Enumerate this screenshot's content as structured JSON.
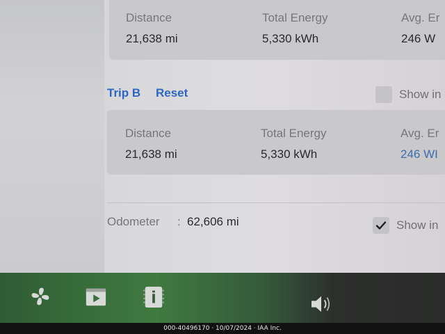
{
  "trip_a": {
    "distance_label": "Distance",
    "distance_value": "21,638 mi",
    "energy_label": "Total Energy",
    "energy_value": "5,330 kWh",
    "avg_label": "Avg. Er",
    "avg_value": "246 W"
  },
  "trip_b": {
    "title": "Trip B",
    "reset_label": "Reset",
    "show_label": "Show in",
    "distance_label": "Distance",
    "distance_value": "21,638 mi",
    "energy_label": "Total Energy",
    "energy_value": "5,330 kWh",
    "avg_label": "Avg. Er",
    "avg_value": "246 WI"
  },
  "odometer": {
    "label": "Odometer",
    "separator": ":",
    "value": "62,606 mi",
    "show_label": "Show in",
    "show_checked": true
  },
  "dock": {
    "icons": [
      "fan-icon",
      "media-player-icon",
      "app-launcher-icon",
      "volume-icon"
    ]
  },
  "caption": "000-40496170 · 10/07/2024 · IAA Inc."
}
